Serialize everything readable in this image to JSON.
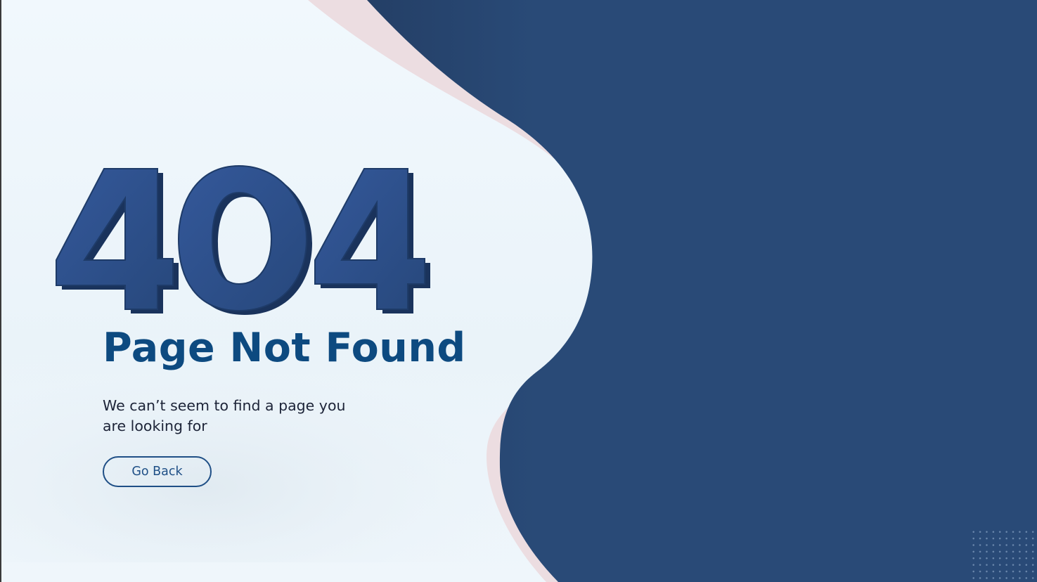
{
  "error": {
    "code": "404",
    "title": "Page Not Found",
    "message": "We can’t seem to find a page you are looking for"
  },
  "actions": {
    "go_back_label": "Go Back"
  },
  "colors": {
    "background": "#eef6fc",
    "navy_panel": "#294a77",
    "pink_wave": "#ecdde1",
    "title": "#0d4a80",
    "digits": "#2b5087",
    "text": "#1d2438",
    "button_border": "#1f4f86"
  },
  "icons": {
    "decor_dots": "dot-grid-pattern",
    "wave": "wave-shape"
  }
}
